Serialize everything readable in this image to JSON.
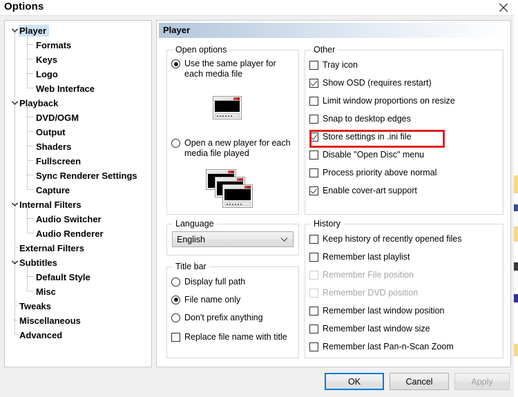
{
  "window": {
    "title": "Options",
    "close_label": "close-icon"
  },
  "sidebar": {
    "items": [
      {
        "label": "Player",
        "level": 0,
        "expander": "chevron-down",
        "selected": true
      },
      {
        "label": "Formats",
        "level": 1,
        "expander": "none",
        "selected": false
      },
      {
        "label": "Keys",
        "level": 1,
        "expander": "none",
        "selected": false
      },
      {
        "label": "Logo",
        "level": 1,
        "expander": "none",
        "selected": false
      },
      {
        "label": "Web Interface",
        "level": 1,
        "expander": "none",
        "selected": false
      },
      {
        "label": "Playback",
        "level": 0,
        "expander": "chevron-down",
        "selected": false
      },
      {
        "label": "DVD/OGM",
        "level": 1,
        "expander": "none",
        "selected": false
      },
      {
        "label": "Output",
        "level": 1,
        "expander": "none",
        "selected": false
      },
      {
        "label": "Shaders",
        "level": 1,
        "expander": "none",
        "selected": false
      },
      {
        "label": "Fullscreen",
        "level": 1,
        "expander": "none",
        "selected": false
      },
      {
        "label": "Sync Renderer Settings",
        "level": 1,
        "expander": "none",
        "selected": false
      },
      {
        "label": "Capture",
        "level": 1,
        "expander": "none",
        "selected": false
      },
      {
        "label": "Internal Filters",
        "level": 0,
        "expander": "chevron-down",
        "selected": false
      },
      {
        "label": "Audio Switcher",
        "level": 1,
        "expander": "none",
        "selected": false
      },
      {
        "label": "Audio Renderer",
        "level": 1,
        "expander": "none",
        "selected": false
      },
      {
        "label": "External Filters",
        "level": 0,
        "expander": "none",
        "selected": false
      },
      {
        "label": "Subtitles",
        "level": 0,
        "expander": "chevron-down",
        "selected": false
      },
      {
        "label": "Default Style",
        "level": 1,
        "expander": "none",
        "selected": false
      },
      {
        "label": "Misc",
        "level": 1,
        "expander": "none",
        "selected": false
      },
      {
        "label": "Tweaks",
        "level": 0,
        "expander": "none",
        "selected": false
      },
      {
        "label": "Miscellaneous",
        "level": 0,
        "expander": "none",
        "selected": false
      },
      {
        "label": "Advanced",
        "level": 0,
        "expander": "none",
        "selected": false
      }
    ]
  },
  "pane": {
    "header": "Player"
  },
  "open_options": {
    "legend": "Open options",
    "radios": [
      {
        "line1": "Use the same player for",
        "line2": "each media file",
        "checked": true
      },
      {
        "line1": "Open a new player for each",
        "line2": "media file played",
        "checked": false
      }
    ]
  },
  "language": {
    "legend": "Language",
    "selected": "English"
  },
  "title_bar": {
    "legend": "Title bar",
    "radios": [
      {
        "label": "Display full path",
        "checked": false
      },
      {
        "label": "File name only",
        "checked": true
      },
      {
        "label": "Don't prefix anything",
        "checked": false
      }
    ],
    "checkbox": {
      "label": "Replace file name with title",
      "checked": false
    }
  },
  "other": {
    "legend": "Other",
    "checkboxes": [
      {
        "label": "Tray icon",
        "checked": false,
        "disabled": false,
        "highlighted": false
      },
      {
        "label": "Show OSD (requires restart)",
        "checked": true,
        "disabled": false,
        "highlighted": false
      },
      {
        "label": "Limit window proportions on resize",
        "checked": false,
        "disabled": false,
        "highlighted": false
      },
      {
        "label": "Snap to desktop edges",
        "checked": false,
        "disabled": false,
        "highlighted": false
      },
      {
        "label": "Store settings in .ini file",
        "checked": true,
        "disabled": false,
        "highlighted": true
      },
      {
        "label": "Disable \"Open Disc\" menu",
        "checked": false,
        "disabled": false,
        "highlighted": false
      },
      {
        "label": "Process priority above normal",
        "checked": false,
        "disabled": false,
        "highlighted": false
      },
      {
        "label": "Enable cover-art support",
        "checked": true,
        "disabled": false,
        "highlighted": false
      }
    ]
  },
  "history": {
    "legend": "History",
    "checkboxes": [
      {
        "label": "Keep history of recently opened files",
        "checked": false,
        "disabled": false
      },
      {
        "label": "Remember last playlist",
        "checked": false,
        "disabled": false
      },
      {
        "label": "Remember File position",
        "checked": false,
        "disabled": true
      },
      {
        "label": "Remember DVD position",
        "checked": false,
        "disabled": true
      },
      {
        "label": "Remember last window position",
        "checked": false,
        "disabled": false
      },
      {
        "label": "Remember last window size",
        "checked": false,
        "disabled": false
      },
      {
        "label": "Remember last Pan-n-Scan Zoom",
        "checked": false,
        "disabled": false
      }
    ]
  },
  "footer": {
    "ok": "OK",
    "cancel": "Cancel",
    "apply": "Apply",
    "apply_disabled": true
  },
  "colors": {
    "annotation_red": "#e02020",
    "selection_blue": "#cce4f7",
    "focus_blue": "#0078d7",
    "header_gradient_start": "#b5c7dd"
  }
}
